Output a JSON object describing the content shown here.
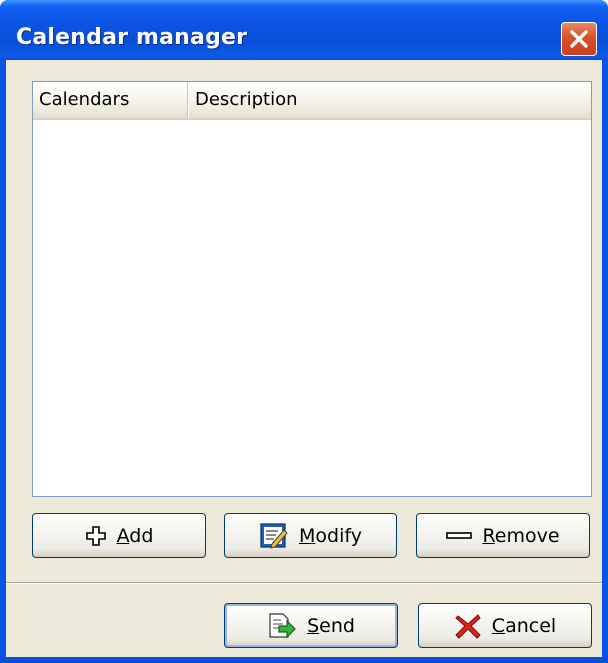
{
  "window": {
    "title": "Calendar manager",
    "close_icon": "close-icon"
  },
  "list": {
    "columns": [
      "Calendars",
      "Description"
    ],
    "rows": []
  },
  "buttons": {
    "add": {
      "label": "Add",
      "mnemonic": "A",
      "rest": "dd",
      "icon": "plus-icon"
    },
    "modify": {
      "label": "Modify",
      "mnemonic": "M",
      "rest": "odify",
      "icon": "edit-document-icon"
    },
    "remove": {
      "label": "Remove",
      "mnemonic": "R",
      "rest": "emove",
      "icon": "minus-icon"
    },
    "send": {
      "label": "Send",
      "mnemonic": "S",
      "rest": "end",
      "icon": "send-document-icon"
    },
    "cancel": {
      "label": "Cancel",
      "mnemonic": "C",
      "rest": "ancel",
      "icon": "red-x-icon"
    }
  },
  "colors": {
    "titlebar": "#0a54e3",
    "client": "#ece9d8",
    "close_button": "#d9502a"
  }
}
